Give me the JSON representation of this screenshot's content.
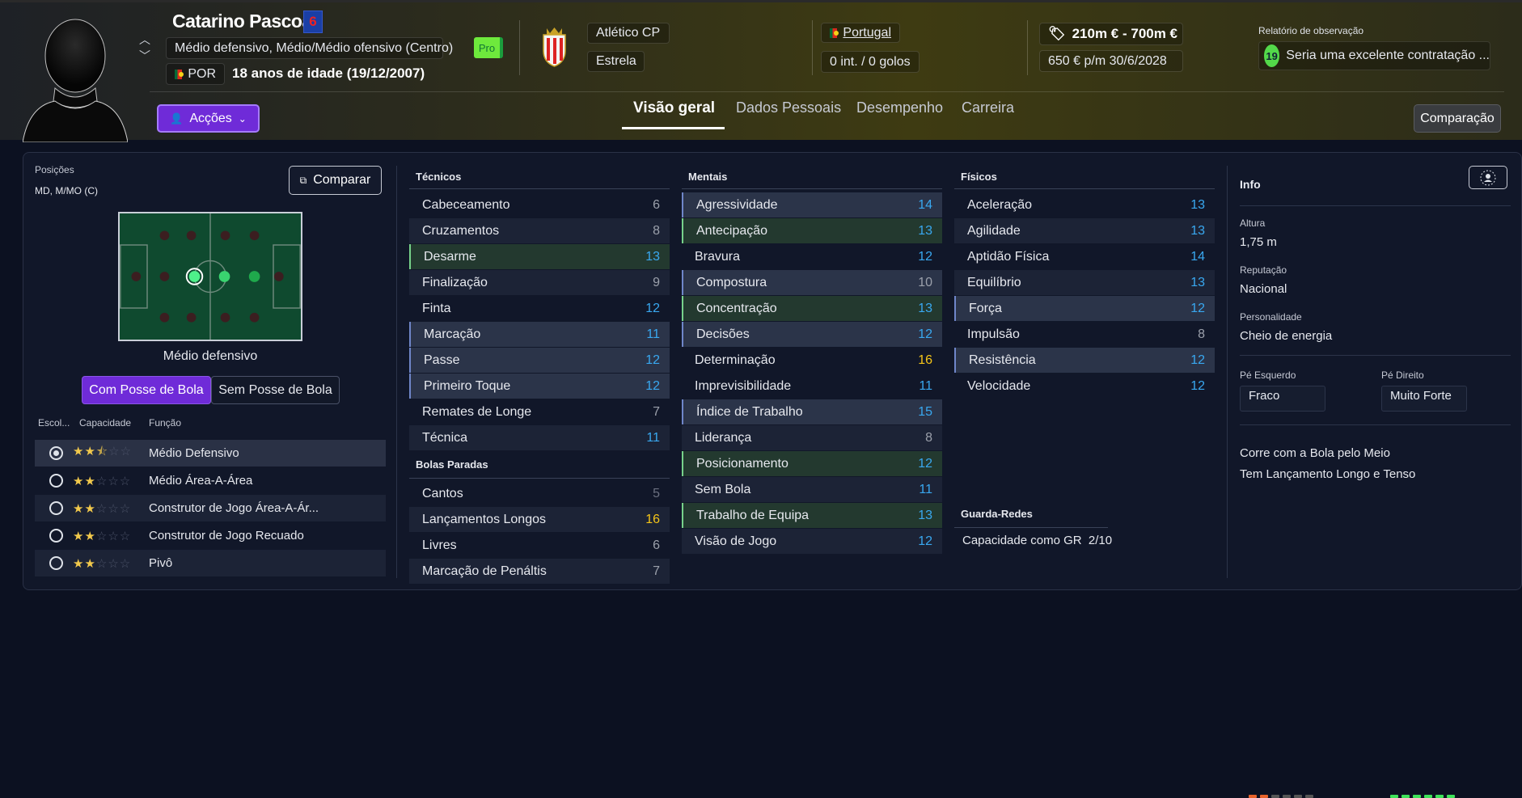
{
  "header": {
    "player_name": "Catarino Pascoal",
    "squad_number": "6",
    "positions_full": "Médio defensivo, Médio/Médio ofensivo (Centro)",
    "nationality_code": "POR",
    "age_text": "18 anos de idade (19/12/2007)",
    "pro_badge": "Pro",
    "club": "Atlético CP",
    "status": "Estrela",
    "country": "Portugal",
    "caps": "0 int. / 0 golos",
    "value_range": "210m € - 700m €",
    "wage_contract": "650 € p/m  30/6/2028",
    "scout_title": "Relatório de observação",
    "scout_score": "19",
    "scout_text": "Seria uma excelente contratação ...",
    "actions_label": "Acções",
    "compare_label": "Comparação",
    "tabs": [
      "Visão geral",
      "Dados Pessoais",
      "Desempenho",
      "Carreira"
    ]
  },
  "left": {
    "positions_label": "Posições",
    "positions_value": "MD, M/MO (C)",
    "compare_label": "Comparar",
    "pitch_label": "Médio defensivo",
    "toggle": [
      "Com Posse de Bola",
      "Sem Posse de Bola"
    ],
    "role_headers": [
      "Escol...",
      "Capacidade",
      "Função"
    ],
    "roles": [
      {
        "name": "Médio Defensivo",
        "stars": 2.5,
        "selected": true
      },
      {
        "name": "Médio Área-A-Área",
        "stars": 2,
        "selected": false
      },
      {
        "name": "Construtor de Jogo Área-A-Ár...",
        "stars": 2,
        "selected": false
      },
      {
        "name": "Construtor de Jogo Recuado",
        "stars": 2,
        "selected": false
      },
      {
        "name": "Pivô",
        "stars": 2,
        "selected": false
      }
    ]
  },
  "attributes": {
    "tecnicos_title": "Técnicos",
    "tecnicos": [
      {
        "n": "Cabeceamento",
        "v": "6"
      },
      {
        "n": "Cruzamentos",
        "v": "8"
      },
      {
        "n": "Desarme",
        "v": "13"
      },
      {
        "n": "Finalização",
        "v": "9"
      },
      {
        "n": "Finta",
        "v": "12"
      },
      {
        "n": "Marcação",
        "v": "11"
      },
      {
        "n": "Passe",
        "v": "12"
      },
      {
        "n": "Primeiro Toque",
        "v": "12"
      },
      {
        "n": "Remates de Longe",
        "v": "7"
      },
      {
        "n": "Técnica",
        "v": "11"
      }
    ],
    "bolas_title": "Bolas Paradas",
    "bolas": [
      {
        "n": "Cantos",
        "v": "5"
      },
      {
        "n": "Lançamentos Longos",
        "v": "16"
      },
      {
        "n": "Livres",
        "v": "6"
      },
      {
        "n": "Marcação de Penáltis",
        "v": "7"
      }
    ],
    "mentais_title": "Mentais",
    "mentais": [
      {
        "n": "Agressividade",
        "v": "14"
      },
      {
        "n": "Antecipação",
        "v": "13"
      },
      {
        "n": "Bravura",
        "v": "12"
      },
      {
        "n": "Compostura",
        "v": "10"
      },
      {
        "n": "Concentração",
        "v": "13"
      },
      {
        "n": "Decisões",
        "v": "12"
      },
      {
        "n": "Determinação",
        "v": "16"
      },
      {
        "n": "Imprevisibilidade",
        "v": "11"
      },
      {
        "n": "Índice de Trabalho",
        "v": "15"
      },
      {
        "n": "Liderança",
        "v": "8"
      },
      {
        "n": "Posicionamento",
        "v": "12"
      },
      {
        "n": "Sem Bola",
        "v": "11"
      },
      {
        "n": "Trabalho de Equipa",
        "v": "13"
      },
      {
        "n": "Visão de Jogo",
        "v": "12"
      }
    ],
    "fisicos_title": "Físicos",
    "fisicos": [
      {
        "n": "Aceleração",
        "v": "13"
      },
      {
        "n": "Agilidade",
        "v": "13"
      },
      {
        "n": "Aptidão Física",
        "v": "14"
      },
      {
        "n": "Equilíbrio",
        "v": "13"
      },
      {
        "n": "Força",
        "v": "12"
      },
      {
        "n": "Impulsão",
        "v": "8"
      },
      {
        "n": "Resistência",
        "v": "12"
      },
      {
        "n": "Velocidade",
        "v": "12"
      }
    ],
    "gk_title": "Guarda-Redes",
    "gk_label": "Capacidade como GR",
    "gk_value": "2/10"
  },
  "info": {
    "title": "Info",
    "height_label": "Altura",
    "height": "1,75 m",
    "reputation_label": "Reputação",
    "reputation": "Nacional",
    "personality_label": "Personalidade",
    "personality": "Cheio de energia",
    "left_foot_label": "Pé Esquerdo",
    "left_foot": "Fraco",
    "right_foot_label": "Pé Direito",
    "right_foot": "Muito Forte",
    "traits": [
      "Corre com a Bola pelo Meio",
      "Tem Lançamento Longo e Tenso"
    ]
  }
}
